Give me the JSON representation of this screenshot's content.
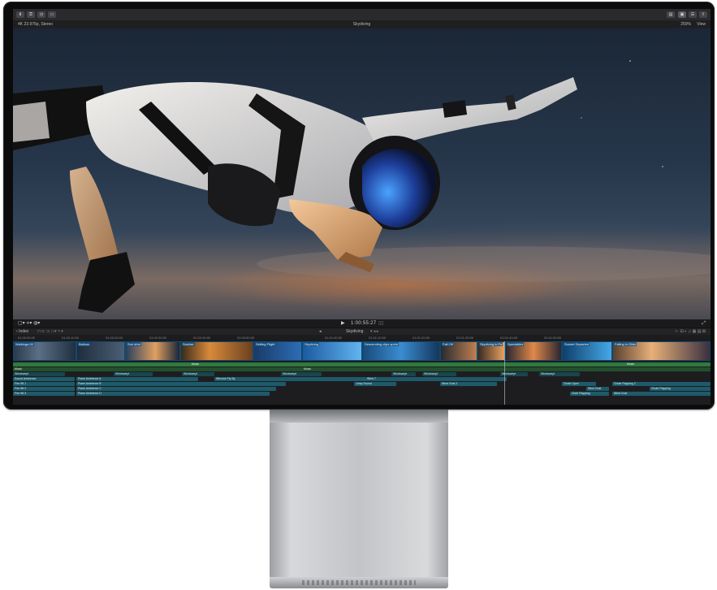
{
  "app": {
    "project_title": "Skydiving",
    "viewer_left": "4K 23.976p, Stereo",
    "zoom": "250%",
    "view_menu": "View"
  },
  "viewer_controls": {
    "timecode": "1:00:55:27"
  },
  "timeline_toolbar": {
    "index_label": "Index",
    "project_name": "Skydiving"
  },
  "ruler": [
    "01:00:00:00",
    "01:00:10:00",
    "01:00:20:00",
    "01:00:30:00",
    "01:00:40:00",
    "01:00:50:00",
    "01:01:00:00",
    "01:01:10:00",
    "01:01:20:00",
    "01:01:30:00",
    "01:01:40:00",
    "01:01:50:00"
  ],
  "clips": [
    {
      "label": "Walkings-00"
    },
    {
      "label": "Balloon"
    },
    {
      "label": "Sun shot"
    },
    {
      "label": "Sunrise"
    },
    {
      "label": "Setting Flight"
    },
    {
      "label": "Skydiving"
    },
    {
      "label": "Descending clips sprint"
    },
    {
      "label": "Fall Off"
    },
    {
      "label": "Skydiving to Fa"
    },
    {
      "label": "Specialties"
    },
    {
      "label": "Sunset Departed"
    },
    {
      "label": "Falling in Glide"
    }
  ],
  "lanes": {
    "music": "Music",
    "music_b": "Music",
    "wind_left": "Windswept",
    "wind_mid": "Windswept",
    "ambience_a": "Sound Ambience",
    "plane_a": "Plane Ambience A",
    "plane_b": "Plane Ambience B",
    "plane_c": "Plane Ambience C",
    "plane_d": "Plane Ambience D",
    "whoosh_a": "Whoosh Fly By",
    "wind7": "Wind 7",
    "jump": "Jump Sound",
    "wind_gust": "Wind Gust 2",
    "chute": "Chute Open",
    "chute_flap": "Chute Flapping 2",
    "fly_1": "Fire Wt 1",
    "fly_2": "Fire Wt 2",
    "fly_3": "Fire Wt 3",
    "cloth_a": "Cloth Flapping",
    "cloth_b": "Wind Gust",
    "cloth_c": "Chute Flapping"
  },
  "colors": {
    "music": "#2f7a3e",
    "fx": "#1e5a6a",
    "clip_border": "#0f4a6e"
  }
}
